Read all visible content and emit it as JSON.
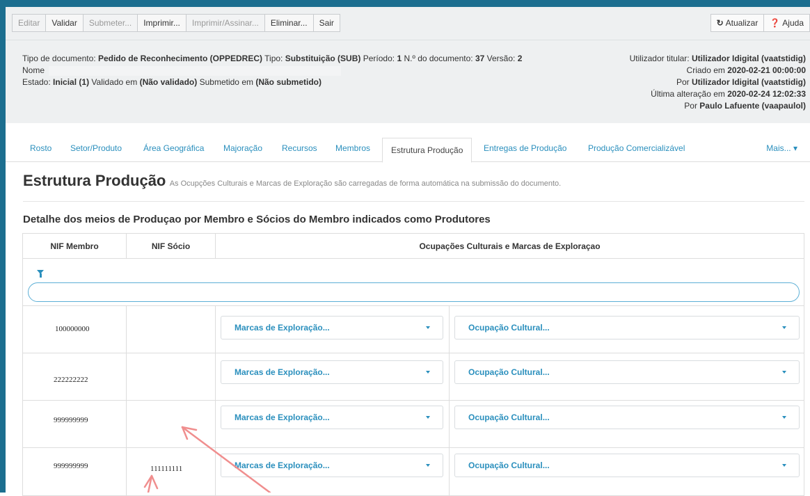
{
  "toolbar": {
    "buttons": [
      {
        "label": "Editar",
        "enabled": false
      },
      {
        "label": "Validar",
        "enabled": true
      },
      {
        "label": "Submeter...",
        "enabled": false
      },
      {
        "label": "Imprimir...",
        "enabled": true
      },
      {
        "label": "Imprimir/Assinar...",
        "enabled": false
      },
      {
        "label": "Eliminar...",
        "enabled": true
      },
      {
        "label": "Sair",
        "enabled": true
      }
    ],
    "refresh_label": "Atualizar",
    "help_label": "Ajuda"
  },
  "info": {
    "doc_type_label": "Tipo de documento:",
    "doc_type_value": "Pedido de Reconhecimento (OPPEDREC)",
    "type_label": "Tipo:",
    "type_value": "Substituição (SUB)",
    "period_label": "Período:",
    "period_value": "1",
    "doc_number_label": "N.º do documento:",
    "doc_number_value": "37",
    "version_label": "Versão:",
    "version_value": "2",
    "name_label": "Nome",
    "state_label": "Estado:",
    "state_value": "Inicial (1)",
    "validated_label": "Validado em",
    "validated_value": "(Não validado)",
    "submitted_label": "Submetido em",
    "submitted_value": "(Não submetido)",
    "holder_label": "Utilizador titular:",
    "holder_value": "Utilizador Idigital (vaatstidig)",
    "created_label": "Criado em",
    "created_value": "2020-02-21 00:00:00",
    "created_by_label": "Por",
    "created_by_value": "Utilizador Idigital (vaatstidig)",
    "modified_label": "Última alteração em",
    "modified_value": "2020-02-24 12:02:33",
    "modified_by_label": "Por",
    "modified_by_value": "Paulo Lafuente (vaapaulol)"
  },
  "tabs": [
    {
      "label": "Rosto"
    },
    {
      "label": "Setor/Produto"
    },
    {
      "label": "Área Geográfica"
    },
    {
      "label": "Majoração"
    },
    {
      "label": "Recursos"
    },
    {
      "label": "Membros"
    },
    {
      "label": "Estrutura Produção"
    },
    {
      "label": "Entregas de Produção"
    },
    {
      "label": "Produção Comercializável"
    }
  ],
  "tab_more": "Mais... ▾",
  "section": {
    "title": "Estrutura Produção",
    "note": "As Ocupções Culturais e Marcas de Exploração são carregadas de forma automática na submissão do documento.",
    "subtitle": "Detalhe dos meios de Produçao por Membro e Sócios do Membro indicados como Produtores"
  },
  "table": {
    "columns": [
      "NIF Membro",
      "NIF Sócio",
      "Ocupações Culturais e Marcas de Exploraçao"
    ],
    "search_value": "",
    "rows": [
      {
        "nif_membro": "100000000",
        "nif_socio": "",
        "marcas": "Marcas de Exploração...",
        "ocupacao": "Ocupação Cultural..."
      },
      {
        "nif_membro": "222222222",
        "nif_socio": "",
        "marcas": "Marcas de Exploração...",
        "ocupacao": "Ocupação Cultural..."
      },
      {
        "nif_membro": "999999999",
        "nif_socio": "",
        "marcas": "Marcas de Exploração...",
        "ocupacao": "Ocupação Cultural..."
      },
      {
        "nif_membro": "999999999",
        "nif_socio": "111111111",
        "marcas": "Marcas de Exploração...",
        "ocupacao": "Ocupação Cultural..."
      }
    ]
  },
  "colors": {
    "accent": "#2a8fbd",
    "frame": "#1c6e8f",
    "annotation_arrow": "#f08e8e"
  }
}
